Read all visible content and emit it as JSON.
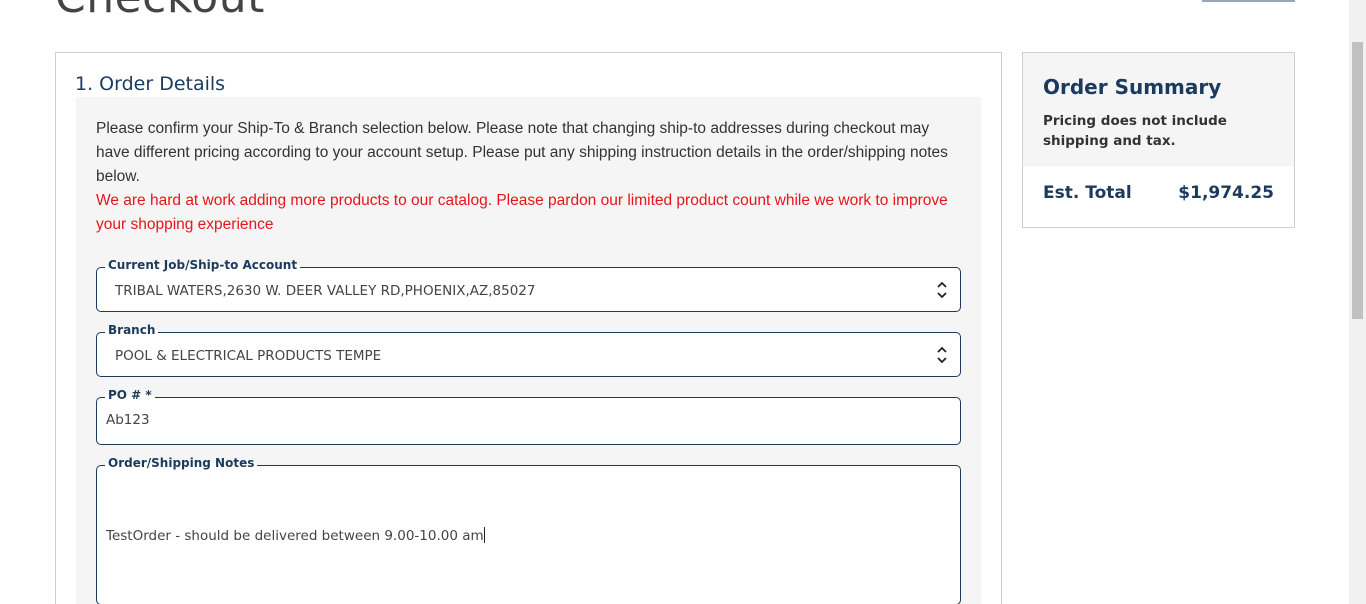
{
  "page": {
    "title": "Checkout"
  },
  "order_details": {
    "heading": "1. Order Details",
    "intro": "Please confirm your Ship-To & Branch selection below. Please note that changing ship-to addresses during checkout may have different pricing according to your account setup. Please put any shipping instruction details in the order/shipping notes below.",
    "notice": "We are hard at work adding more products to our catalog. Please pardon our limited product count while we work to improve your shopping experience",
    "ship_to": {
      "label": "Current Job/Ship-to Account",
      "value": "TRIBAL WATERS,2630 W. DEER VALLEY RD,PHOENIX,AZ,85027"
    },
    "branch": {
      "label": "Branch",
      "value": "POOL & ELECTRICAL PRODUCTS TEMPE"
    },
    "po": {
      "label": "PO # *",
      "value": "Ab123"
    },
    "notes": {
      "label": "Order/Shipping Notes",
      "value": "TestOrder - should be delivered between 9.00-10.00 am"
    }
  },
  "summary": {
    "title": "Order Summary",
    "note": "Pricing does not include shipping and tax.",
    "est_total_label": "Est. Total",
    "est_total_value": "$1,974.25"
  },
  "colors": {
    "accent": "#1b3a5c",
    "notice": "#e8141b",
    "panel_bg": "#f5f5f5"
  },
  "scroll": {
    "position_fraction": 0.07
  }
}
